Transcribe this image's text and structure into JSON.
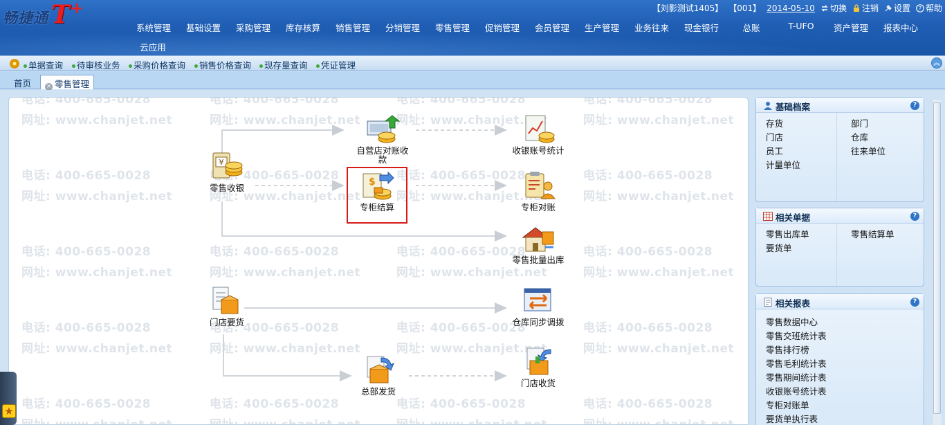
{
  "app": {
    "logo_text": "畅捷通",
    "logo_brand": "T",
    "logo_plus": "+"
  },
  "userbar": {
    "user": "【刘影测试1405】",
    "account": "【001】",
    "date": "2014-05-10",
    "switch_label": "切换",
    "logout_label": "注销",
    "settings_label": "设置",
    "help_label": "帮助"
  },
  "topnav": {
    "items": [
      "系统管理",
      "基础设置",
      "采购管理",
      "库存核算",
      "销售管理",
      "分销管理",
      "零售管理",
      "促销管理",
      "会员管理",
      "生产管理",
      "业务往来",
      "现金银行",
      "总账",
      "T-UFO",
      "资产管理",
      "报表中心"
    ],
    "cloud": "云应用"
  },
  "quickbar": {
    "items": [
      "单据查询",
      "待审核业务",
      "采购价格查询",
      "销售价格查询",
      "现存量查询",
      "凭证管理"
    ]
  },
  "tabs": [
    {
      "label": "首页",
      "active": false
    },
    {
      "label": "零售管理",
      "active": true
    }
  ],
  "watermark": {
    "phone": "电话: 400-665-0028",
    "url": "网址: www.chanjet.net"
  },
  "flow": {
    "nodes": {
      "retail_cashier": "零售收银",
      "self_store_recon": "自营店对账收款",
      "cashier_account_stats": "收银账号统计",
      "counter_settlement": "专柜结算",
      "counter_recon": "专柜对账",
      "retail_batch_out": "零售批量出库",
      "store_requisition": "门店要货",
      "warehouse_sync_transfer": "仓库同步调拨",
      "hq_shipment": "总部发货",
      "store_receipt": "门店收货"
    }
  },
  "panels": {
    "basic_archives": {
      "title": "基础档案",
      "left": [
        "存货",
        "门店",
        "员工",
        "计量单位"
      ],
      "right": [
        "部门",
        "仓库",
        "往来单位"
      ]
    },
    "related_documents": {
      "title": "相关单据",
      "left": [
        "零售出库单",
        "要货单"
      ],
      "right": [
        "零售结算单"
      ]
    },
    "related_reports": {
      "title": "相关报表",
      "items": [
        "零售数据中心",
        "零售交班统计表",
        "零售排行榜",
        "零售毛利统计表",
        "零售期间统计表",
        "收银账号统计表",
        "专柜对账单",
        "要货单执行表"
      ]
    }
  },
  "colors": {
    "header_blue": "#1f5eb4",
    "selection_red": "#d61a1a",
    "accent_orange": "#f0a020"
  }
}
